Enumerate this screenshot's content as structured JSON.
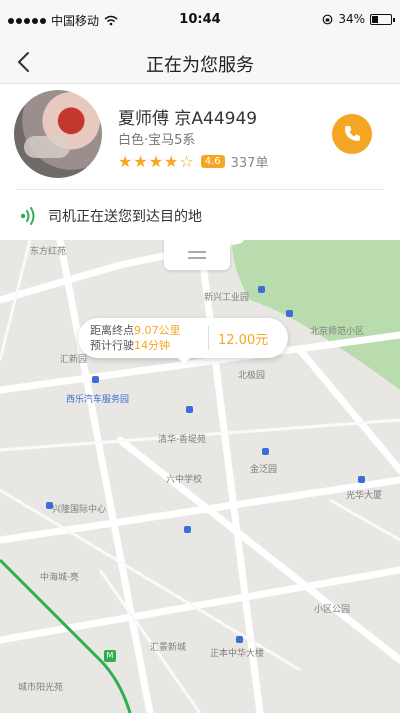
{
  "status_bar": {
    "carrier": "中国移动",
    "time": "10:44",
    "battery": "34%",
    "battery_level": 0.34
  },
  "nav": {
    "title": "正在为您服务"
  },
  "driver": {
    "name": "夏师傅 京A44949",
    "car": "白色·宝马5系",
    "stars": "★★★★☆",
    "score": "4.6",
    "orders": "337单"
  },
  "trip_status": {
    "text": "司机正在送您到达目的地"
  },
  "map": {
    "bubble": {
      "line1_prefix": "距离终点",
      "line1_value": "9.07公里",
      "line2_prefix": "预计行驶",
      "line2_value": "14分钟",
      "price": "12.00元"
    },
    "labels": [
      "东方红苑",
      "新兴工业园",
      "汇新园",
      "西乐汽车服务园",
      "北极园",
      "北京师范小区",
      "清华·香堤苑",
      "光华大厦",
      "金泛园",
      "六中学校",
      "兴隆国际中心",
      "中海城·亮",
      "城市阳光苑",
      "汇景新城",
      "正本中华大楼",
      "小区公园"
    ]
  },
  "colors": {
    "accent": "#f5a623",
    "status_green": "#2fae4f",
    "map_water": "#a9d3a4",
    "poi_blue": "#3b6fd6"
  },
  "icons": {
    "back": "chevron-left-icon",
    "call": "phone-icon",
    "status": "signal-waves-icon",
    "handle": "drag-handle-icon"
  }
}
